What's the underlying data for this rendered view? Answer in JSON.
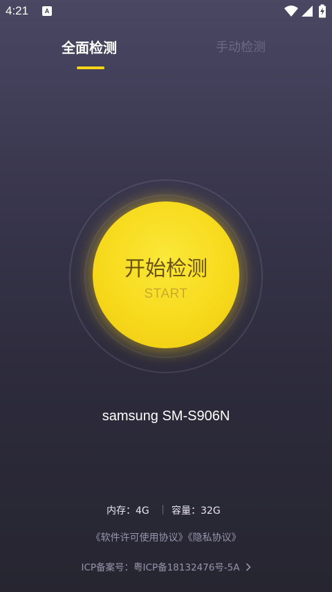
{
  "status_bar": {
    "time": "4:21",
    "notification_icon_letter": "A",
    "icons": [
      "wifi-icon",
      "signal-icon",
      "battery-icon"
    ]
  },
  "tabs": [
    {
      "label": "全面检测",
      "active": true
    },
    {
      "label": "手动检测",
      "active": false
    }
  ],
  "start_button": {
    "label": "开始检测",
    "sub_label": "START"
  },
  "device": {
    "name": "samsung SM-S906N"
  },
  "specs": {
    "memory": "内存：4G",
    "storage": "容量：32G"
  },
  "agreements": {
    "license": "《软件许可使用协议》",
    "privacy": "《隐私协议》"
  },
  "icp": {
    "text": "ICP备案号：粤ICP备18132476号-5A"
  },
  "colors": {
    "accent": "#f7d416",
    "background_top": "#4a4763",
    "background_bottom": "#262530",
    "button_text": "#6b5210"
  }
}
